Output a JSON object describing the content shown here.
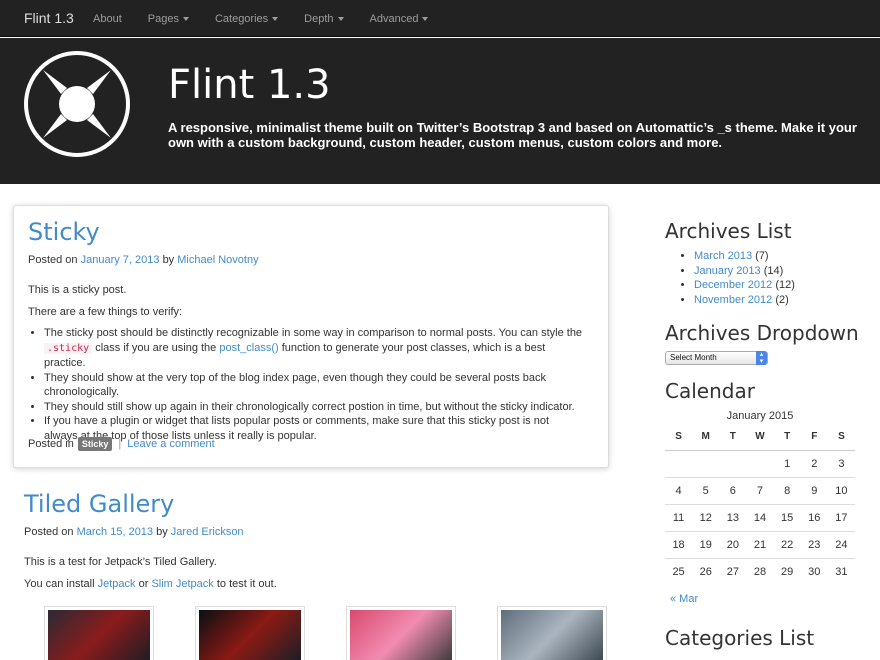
{
  "navbar": {
    "brand": "Flint 1.3",
    "items": [
      {
        "label": "About",
        "caret": false
      },
      {
        "label": "Pages",
        "caret": true
      },
      {
        "label": "Categories",
        "caret": true
      },
      {
        "label": "Depth",
        "caret": true
      },
      {
        "label": "Advanced",
        "caret": true
      }
    ]
  },
  "header": {
    "title": "Flint 1.3",
    "description": "A responsive, minimalist theme built on Twitter’s Bootstrap 3 and based on Automattic’s _s theme. Make it your own with a custom background, custom header, custom menus, custom colors and more."
  },
  "post1": {
    "title": "Sticky",
    "posted_on": "Posted on",
    "date": "January 7, 2013",
    "by": "by",
    "author": "Michael Novotny",
    "para1": "This is a sticky post.",
    "para2": "There are a few things to verify:",
    "b1_pre": "The sticky post should be distinctly recognizable in some way in comparison to normal posts. You can style the",
    "b1_code": ".sticky",
    "b1_mid": "class if you are using the",
    "b1_link": "post_class()",
    "b1_post": "function to generate your post classes, which is a best practice.",
    "b2": "They should show at the very top of the blog index page, even though they could be several posts back chronologically.",
    "b3": "They should still show up again in their chronologically correct postion in time, but without the sticky indicator.",
    "b4": "If you have a plugin or widget that lists popular posts or comments, make sure that this sticky post is not always at the top of those lists unless it really is popular.",
    "posted_in": "Posted in",
    "category": "Sticky",
    "separator": "|",
    "comment_link": "Leave a comment"
  },
  "post2": {
    "title": "Tiled Gallery",
    "posted_on": "Posted on",
    "date": "March 15, 2013",
    "by": "by",
    "author": "Jared Erickson",
    "para1": "This is a test for Jetpack’s Tiled Gallery.",
    "para2_pre": "You can install",
    "link1": "Jetpack",
    "or": "or",
    "link2": "Slim Jetpack",
    "para2_post": "to test it out.",
    "thumbs": [
      {
        "name": "iron-man-thumb",
        "colors": [
          "#2a2a35",
          "#8b1c1c",
          "#1d1d24"
        ]
      },
      {
        "name": "superman-thumb",
        "colors": [
          "#0b0f14",
          "#8b1a14",
          "#1a1f26"
        ]
      },
      {
        "name": "fight-club-thumb",
        "colors": [
          "#d9486f",
          "#f28cb1",
          "#3a3a3a"
        ]
      },
      {
        "name": "city-street-thumb",
        "colors": [
          "#5f6e7c",
          "#aab5bf",
          "#3b4650"
        ]
      }
    ]
  },
  "sidebar": {
    "archives_title": "Archives List",
    "archives": [
      {
        "label": "March 2013",
        "count": "(7)"
      },
      {
        "label": "January 2013",
        "count": "(14)"
      },
      {
        "label": "December 2012",
        "count": "(12)"
      },
      {
        "label": "November 2012",
        "count": "(2)"
      }
    ],
    "dropdown_title": "Archives Dropdown",
    "dropdown_value": "Select Month",
    "calendar_title": "Calendar",
    "calendar_caption": "January 2015",
    "weekdays": [
      "S",
      "M",
      "T",
      "W",
      "T",
      "F",
      "S"
    ],
    "weeks": [
      [
        "",
        "",
        "",
        "",
        "1",
        "2",
        "3"
      ],
      [
        "4",
        "5",
        "6",
        "7",
        "8",
        "9",
        "10"
      ],
      [
        "11",
        "12",
        "13",
        "14",
        "15",
        "16",
        "17"
      ],
      [
        "18",
        "19",
        "20",
        "21",
        "22",
        "23",
        "24"
      ],
      [
        "25",
        "26",
        "27",
        "28",
        "29",
        "30",
        "31"
      ]
    ],
    "prev_month": "« Mar",
    "categories_title": "Categories List"
  }
}
